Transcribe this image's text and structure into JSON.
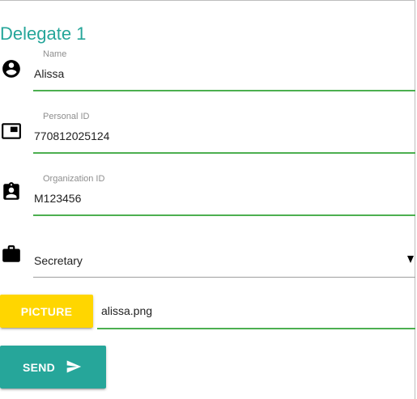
{
  "form": {
    "title": "Delegate 1",
    "name": {
      "label": "Name",
      "value": "Alissa",
      "icon": "account-circle-icon"
    },
    "personal_id": {
      "label": "Personal ID",
      "value": "770812025124",
      "icon": "id-card-icon"
    },
    "organization_id": {
      "label": "Organization ID",
      "value": "M123456",
      "icon": "badge-icon"
    },
    "role": {
      "value": "Secretary",
      "icon": "briefcase-icon"
    },
    "picture": {
      "button_label": "PICTURE",
      "file_name": "alissa.png"
    },
    "send": {
      "button_label": "SEND",
      "icon": "send-icon"
    }
  },
  "colors": {
    "title": "#26a69a",
    "underline_active": "#4caf50",
    "picture_button": "#ffd600",
    "send_button": "#26a69a"
  }
}
